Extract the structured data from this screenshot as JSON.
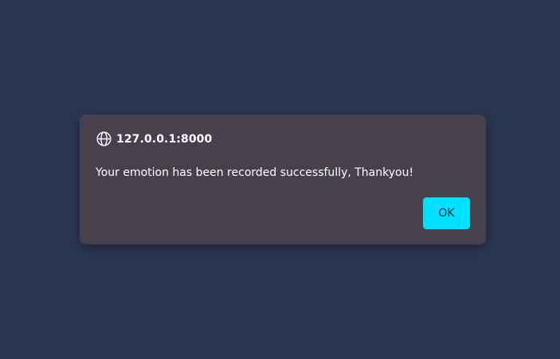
{
  "dialog": {
    "origin": "127.0.0.1:8000",
    "message": "Your emotion has been recorded successfully, Thankyou!",
    "ok_label": "OK",
    "icon": "globe-icon"
  },
  "colors": {
    "page_background": "#2b3753",
    "dialog_background": "#46414d",
    "accent_button": "#00e1ff",
    "text": "#ffffff"
  }
}
